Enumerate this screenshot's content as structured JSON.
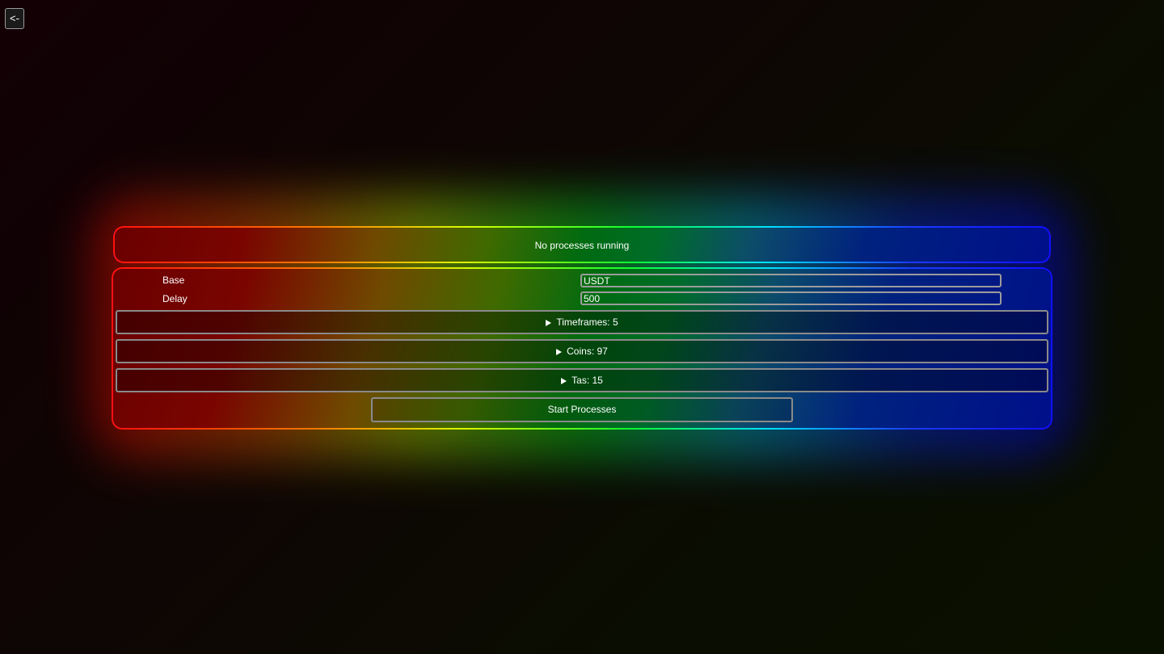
{
  "nav": {
    "back_label": "<-"
  },
  "status": {
    "text": "No processes running"
  },
  "form": {
    "base": {
      "label": "Base",
      "value": "USDT"
    },
    "delay": {
      "label": "Delay",
      "value": "500"
    }
  },
  "sections": [
    {
      "label": "Timeframes: 5"
    },
    {
      "label": "Coins: 97"
    },
    {
      "label": "Tas: 15"
    }
  ],
  "actions": {
    "start_label": "Start Processes"
  },
  "colors": {
    "glow_left": "#ff1010",
    "glow_mid": "#10ff30",
    "glow_right": "#1010ff",
    "border_gray": "#9c9c9c"
  }
}
